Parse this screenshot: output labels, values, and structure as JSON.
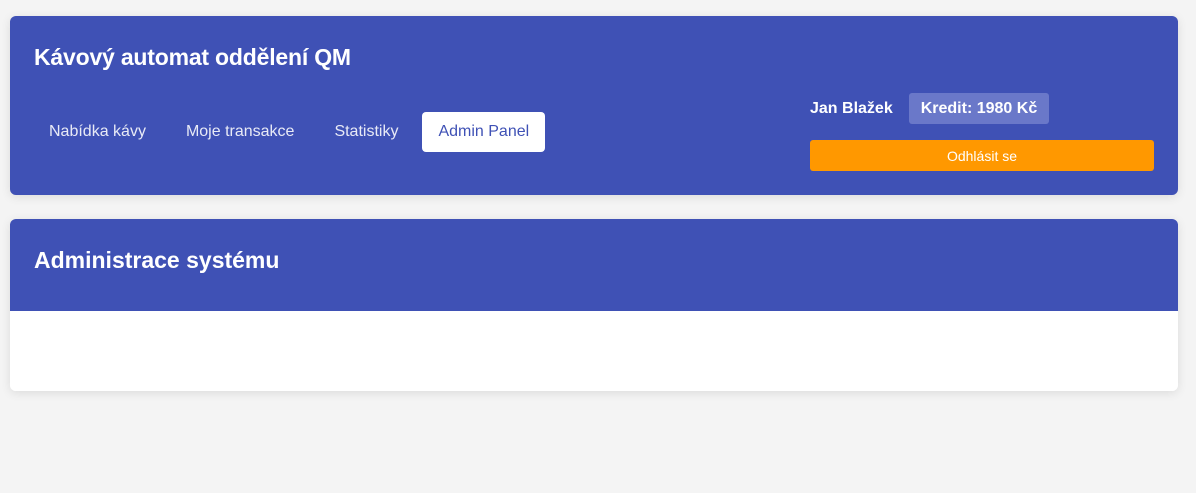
{
  "header": {
    "title": "Kávový automat oddělení QM",
    "nav": [
      {
        "label": "Nabídka kávy",
        "active": false
      },
      {
        "label": "Moje transakce",
        "active": false
      },
      {
        "label": "Statistiky",
        "active": false
      },
      {
        "label": "Admin Panel",
        "active": true
      }
    ],
    "user": {
      "name": "Jan Blažek",
      "credit": "Kredit: 1980 Kč",
      "logout_label": "Odhlásit se"
    }
  },
  "admin": {
    "title": "Administrace systému"
  },
  "colors": {
    "primary": "#3f51b5",
    "accent": "#ff9800",
    "background": "#f4f4f4",
    "badge": "#6a78c9"
  }
}
